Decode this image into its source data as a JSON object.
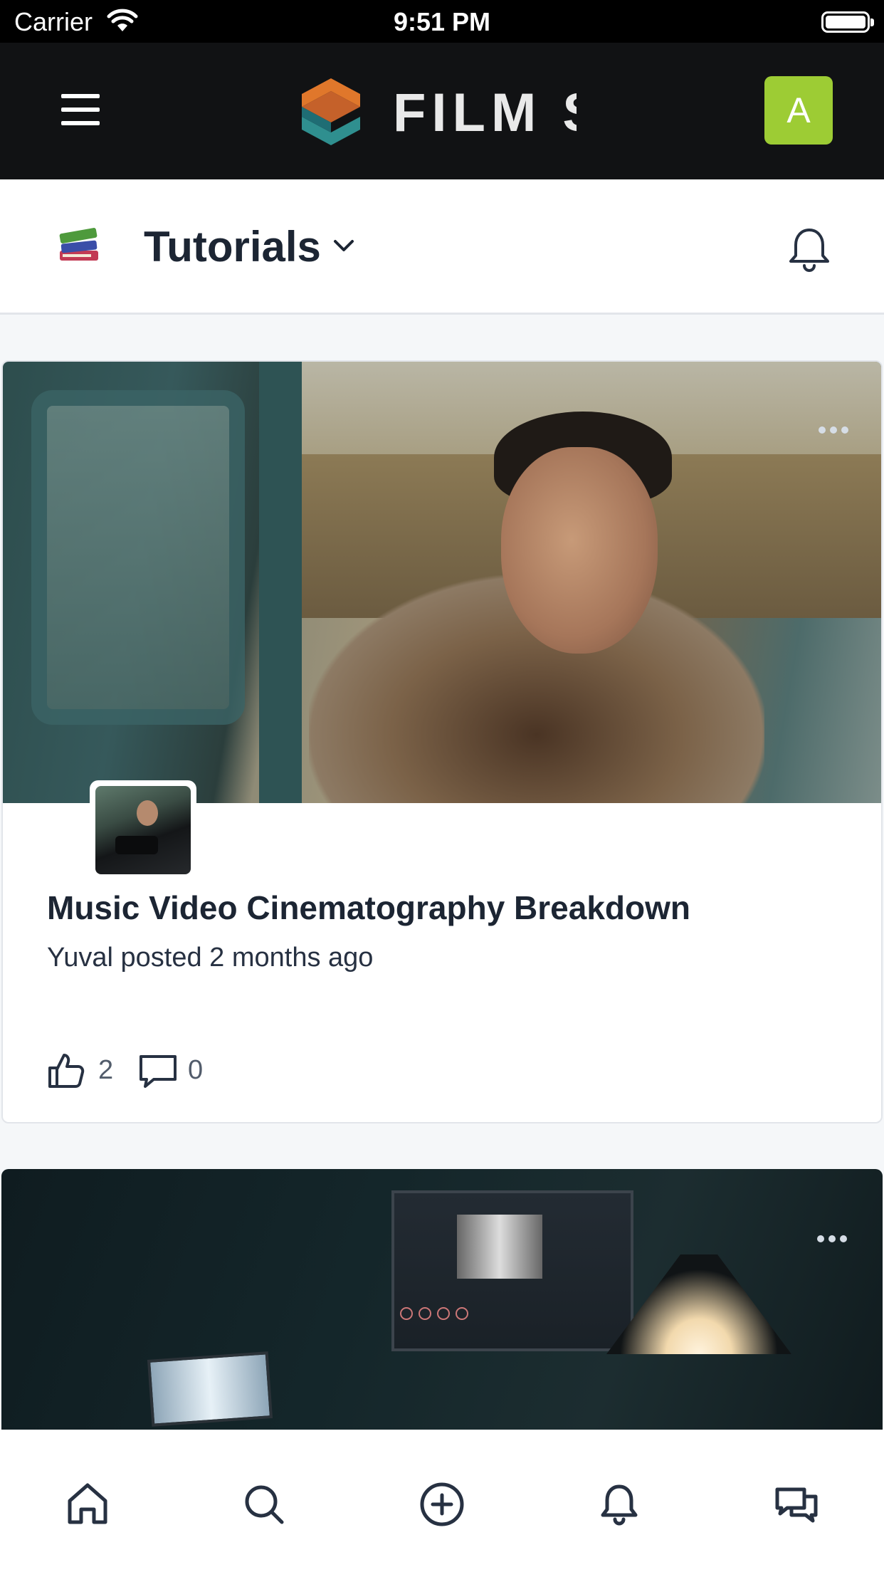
{
  "status_bar": {
    "carrier": "Carrier",
    "time": "9:51 PM"
  },
  "app_bar": {
    "brand_text": "FILM SI",
    "avatar_initial": "A",
    "avatar_color": "#9dcc34"
  },
  "space_header": {
    "title": "Tutorials",
    "icon": "books-emoji-icon"
  },
  "posts": [
    {
      "title": "Music Video Cinematography Breakdown",
      "meta": "Yuval posted 2 months ago",
      "likes": "2",
      "comments": "0"
    }
  ],
  "tab_bar": {
    "items": [
      "home-icon",
      "search-icon",
      "create-icon",
      "notifications-icon",
      "messages-icon"
    ]
  },
  "colors": {
    "app_bar_bg": "#111214",
    "text_primary": "#1c2533",
    "accent_green": "#9dcc34"
  }
}
